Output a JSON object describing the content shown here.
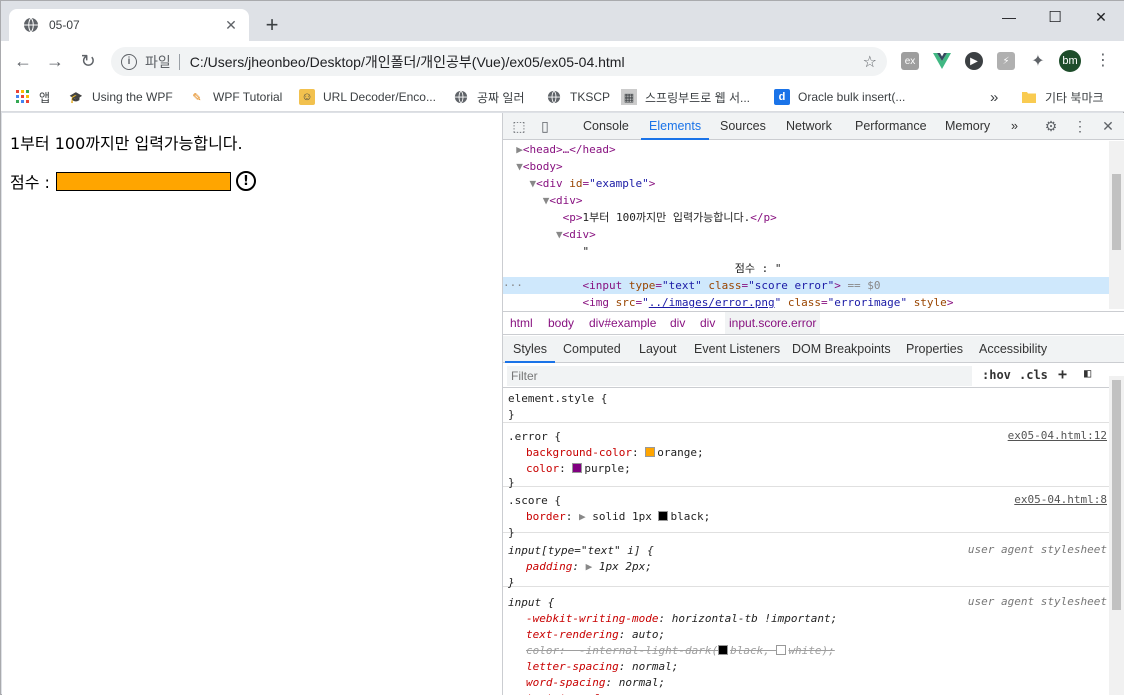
{
  "tab": {
    "title": "05-07"
  },
  "toolbar": {
    "scheme_label": "파일",
    "url": "C:/Users/jheonbeo/Desktop/개인폴더/개인공부(Vue)/ex05/ex05-04.html",
    "avatar": "bm"
  },
  "bookmarks": {
    "items": [
      {
        "label": "앱",
        "icon": "apps-grid-icon"
      },
      {
        "label": "Using the WPF",
        "icon": "graduation-cap-icon"
      },
      {
        "label": "WPF Tutorial",
        "icon": "wpf-logo-icon"
      },
      {
        "label": "URL Decoder/Enco...",
        "icon": "decoder-icon"
      },
      {
        "label": "공짜 일러",
        "icon": "globe-icon"
      },
      {
        "label": "TKSCP",
        "icon": "globe-icon"
      },
      {
        "label": "스프링부트로 웹 서...",
        "icon": "spring-icon"
      },
      {
        "label": "Oracle bulk insert(...",
        "icon": "d-icon"
      }
    ],
    "more": "»",
    "other": "기타 북마크"
  },
  "page": {
    "message": "1부터 100까지만 입력가능합니다.",
    "score_label": "점수 :",
    "input_bg": "#ffa500",
    "input_color": "#800080"
  },
  "devtools": {
    "tabs": [
      "Console",
      "Elements",
      "Sources",
      "Network",
      "Performance",
      "Memory"
    ],
    "active_tab": "Elements",
    "more_tabs": "»",
    "dom": {
      "head": "<head>…</head>",
      "body_open": "<body>",
      "div_example": "<div id=\"example\">",
      "div1": "<div>",
      "p_text": "1부터 100까지만 입력가능합니다.",
      "div2": "<div>",
      "quote": "\"",
      "score_text": "점수 : \"",
      "input_line": "<input type=\"text\" class=\"score error\"> == $0",
      "img_src": "../images/error.png",
      "img_class": "errorimage"
    },
    "crumbs": [
      "html",
      "body",
      "div#example",
      "div",
      "div",
      "input.score.error"
    ],
    "sub_tabs": [
      "Styles",
      "Computed",
      "Layout",
      "Event Listeners",
      "DOM Breakpoints",
      "Properties",
      "Accessibility"
    ],
    "filter_placeholder": "Filter",
    "hov": ":hov",
    "cls": ".cls",
    "styles": {
      "element_style": "element.style {",
      "error_selector": ".error {",
      "error_src": "ex05-04.html:12",
      "error_bg_prop": "background-color",
      "error_bg_val": "orange",
      "error_color_prop": "color",
      "error_color_val": "purple",
      "score_selector": ".score {",
      "score_src": "ex05-04.html:8",
      "score_border_prop": "border",
      "score_border_val": "solid 1px",
      "score_border_color": "black",
      "ua_input_text_selector": "input[type=\"text\" i] {",
      "ua_label": "user agent stylesheet",
      "padding_prop": "padding",
      "padding_val": "1px 2px",
      "input_selector": "input {",
      "props": [
        {
          "name": "-webkit-writing-mode",
          "value": "horizontal-tb !important"
        },
        {
          "name": "text-rendering",
          "value": "auto"
        },
        {
          "name": "letter-spacing",
          "value": "normal"
        },
        {
          "name": "word-spacing",
          "value": "normal"
        },
        {
          "name": "text-transform",
          "value": "none"
        }
      ],
      "struck_prop": "color",
      "struck_val_a": "-internal-light-dark(",
      "struck_val_b": "black, ",
      "struck_val_c": "white);"
    }
  }
}
